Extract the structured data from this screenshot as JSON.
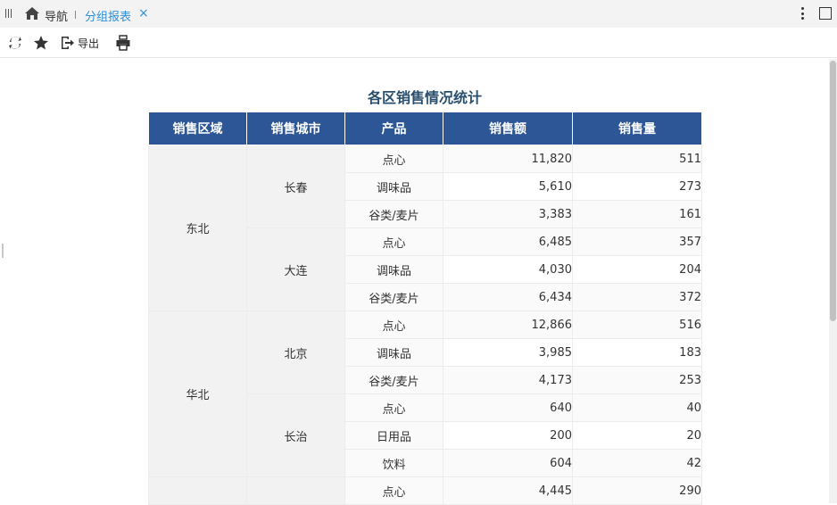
{
  "tabs": {
    "nav_label": "导航",
    "active_label": "分组报表",
    "close_glyph": "×"
  },
  "toolbar": {
    "export_label": "导出"
  },
  "report": {
    "title": "各区销售情况统计",
    "columns": [
      "销售区域",
      "销售城市",
      "产品",
      "销售额",
      "销售量"
    ],
    "groups": [
      {
        "region": "东北",
        "cities": [
          {
            "city": "长春",
            "rows": [
              {
                "product": "点心",
                "amount": "11,820",
                "qty": "511"
              },
              {
                "product": "调味品",
                "amount": "5,610",
                "qty": "273"
              },
              {
                "product": "谷类/麦片",
                "amount": "3,383",
                "qty": "161"
              }
            ]
          },
          {
            "city": "大连",
            "rows": [
              {
                "product": "点心",
                "amount": "6,485",
                "qty": "357"
              },
              {
                "product": "调味品",
                "amount": "4,030",
                "qty": "204"
              },
              {
                "product": "谷类/麦片",
                "amount": "6,434",
                "qty": "372"
              }
            ]
          }
        ]
      },
      {
        "region": "华北",
        "cities": [
          {
            "city": "北京",
            "rows": [
              {
                "product": "点心",
                "amount": "12,866",
                "qty": "516"
              },
              {
                "product": "调味品",
                "amount": "3,985",
                "qty": "183"
              },
              {
                "product": "谷类/麦片",
                "amount": "4,173",
                "qty": "253"
              }
            ]
          },
          {
            "city": "长治",
            "rows": [
              {
                "product": "点心",
                "amount": "640",
                "qty": "40"
              },
              {
                "product": "日用品",
                "amount": "200",
                "qty": "20"
              },
              {
                "product": "饮料",
                "amount": "604",
                "qty": "42"
              }
            ]
          }
        ]
      },
      {
        "region": "",
        "cities": [
          {
            "city": "",
            "rows": [
              {
                "product": "点心",
                "amount": "4,445",
                "qty": "290"
              }
            ]
          }
        ]
      }
    ]
  },
  "colors": {
    "header_bg": "#2c5696",
    "title_color": "#2a4f6e",
    "active_tab": "#2e8fd8"
  },
  "icons": [
    "list-menu-icon",
    "home-icon",
    "close-icon",
    "more-vertical-icon",
    "maximize-icon",
    "refresh-icon",
    "star-icon",
    "export-icon",
    "print-icon"
  ]
}
